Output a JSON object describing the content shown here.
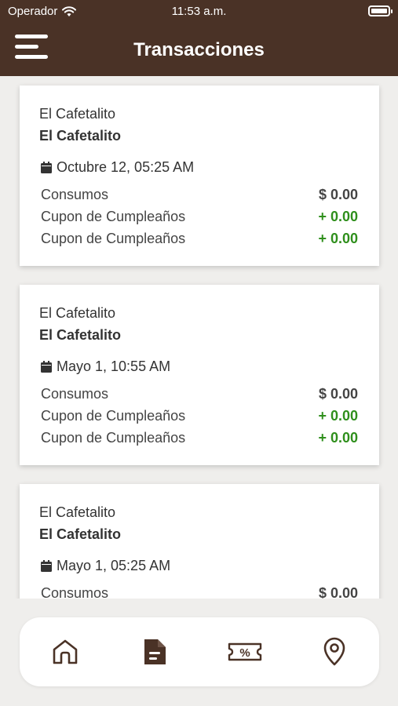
{
  "status_bar": {
    "carrier": "Operador",
    "time": "11:53 a.m."
  },
  "header": {
    "title": "Transacciones"
  },
  "colors": {
    "header_bg": "#4a3226",
    "positive": "#2f8f1c",
    "icon": "#4a3226"
  },
  "transactions": [
    {
      "merchant": "El Cafetalito",
      "merchant_bold": "El Cafetalito",
      "date": "Octubre 12, 05:25 AM",
      "lines": [
        {
          "label": "Consumos",
          "amount": "$ 0.00"
        },
        {
          "label": "Cupon de Cumpleaños",
          "amount": "+ 0.00"
        },
        {
          "label": "Cupon de Cumpleaños",
          "amount": "+ 0.00"
        }
      ]
    },
    {
      "merchant": "El Cafetalito",
      "merchant_bold": "El Cafetalito",
      "date": "Mayo 1, 10:55 AM",
      "lines": [
        {
          "label": "Consumos",
          "amount": "$ 0.00"
        },
        {
          "label": "Cupon de Cumpleaños",
          "amount": "+ 0.00"
        },
        {
          "label": "Cupon de Cumpleaños",
          "amount": "+ 0.00"
        }
      ]
    },
    {
      "merchant": "El Cafetalito",
      "merchant_bold": "El Cafetalito",
      "date": "Mayo 1, 05:25 AM",
      "lines": [
        {
          "label": "Consumos",
          "amount": "$ 0.00"
        }
      ]
    }
  ],
  "nav": {
    "items": [
      {
        "icon": "home-icon"
      },
      {
        "icon": "document-icon"
      },
      {
        "icon": "coupon-icon"
      },
      {
        "icon": "location-pin-icon"
      }
    ]
  }
}
